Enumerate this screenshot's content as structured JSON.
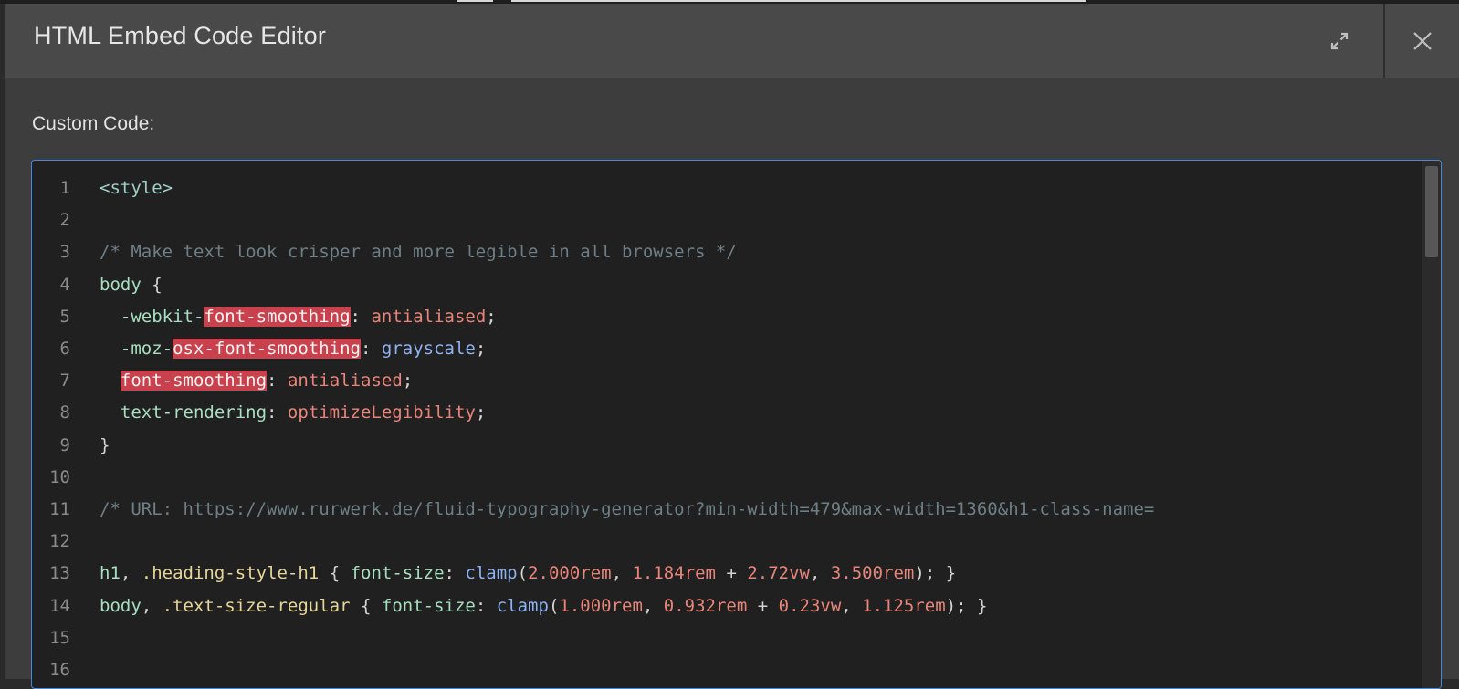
{
  "header": {
    "title": "HTML Embed Code Editor",
    "expand_icon": "expand-icon",
    "close_icon": "close-icon"
  },
  "form": {
    "label": "Custom Code:"
  },
  "editor": {
    "line_numbers": [
      "1",
      "2",
      "3",
      "4",
      "5",
      "6",
      "7",
      "8",
      "9",
      "10",
      "11",
      "12",
      "13",
      "14",
      "15",
      "16"
    ],
    "lines": [
      [
        {
          "t": "<style>",
          "k": "tag"
        }
      ],
      [],
      [
        {
          "t": "/* Make text look crisper and more legible in all browsers */",
          "k": "comment"
        }
      ],
      [
        {
          "t": "body",
          "k": "selector"
        },
        {
          "t": " {",
          "k": "punct"
        }
      ],
      [
        {
          "t": "  -webkit-",
          "k": "prop"
        },
        {
          "t": "font-smoothing",
          "k": "hl"
        },
        {
          "t": ": ",
          "k": "punct"
        },
        {
          "t": "antialiased",
          "k": "val"
        },
        {
          "t": ";",
          "k": "punct"
        }
      ],
      [
        {
          "t": "  -moz-",
          "k": "prop"
        },
        {
          "t": "osx-font-smoothing",
          "k": "hl"
        },
        {
          "t": ": ",
          "k": "punct"
        },
        {
          "t": "grayscale",
          "k": "kw"
        },
        {
          "t": ";",
          "k": "punct"
        }
      ],
      [
        {
          "t": "  ",
          "k": "punct"
        },
        {
          "t": "font-smoothing",
          "k": "hl"
        },
        {
          "t": ": ",
          "k": "punct"
        },
        {
          "t": "antialiased",
          "k": "val"
        },
        {
          "t": ";",
          "k": "punct"
        }
      ],
      [
        {
          "t": "  text-rendering",
          "k": "prop"
        },
        {
          "t": ": ",
          "k": "punct"
        },
        {
          "t": "optimizeLegibility",
          "k": "val"
        },
        {
          "t": ";",
          "k": "punct"
        }
      ],
      [
        {
          "t": "}",
          "k": "punct"
        }
      ],
      [],
      [
        {
          "t": "/* URL: https://www.rurwerk.de/fluid-typography-generator?min-width=479&max-width=1360&h1-class-name=",
          "k": "comment"
        }
      ],
      [],
      [
        {
          "t": "h1",
          "k": "selector"
        },
        {
          "t": ", ",
          "k": "punct"
        },
        {
          "t": ".heading-style-h1",
          "k": "class"
        },
        {
          "t": " { ",
          "k": "punct"
        },
        {
          "t": "font-size",
          "k": "prop"
        },
        {
          "t": ": ",
          "k": "punct"
        },
        {
          "t": "clamp",
          "k": "kw"
        },
        {
          "t": "(",
          "k": "punct"
        },
        {
          "t": "2.000rem",
          "k": "val"
        },
        {
          "t": ", ",
          "k": "punct"
        },
        {
          "t": "1.184rem",
          "k": "val"
        },
        {
          "t": " + ",
          "k": "punct"
        },
        {
          "t": "2.72vw",
          "k": "val"
        },
        {
          "t": ", ",
          "k": "punct"
        },
        {
          "t": "3.500rem",
          "k": "val"
        },
        {
          "t": "); }",
          "k": "punct"
        }
      ],
      [
        {
          "t": "body",
          "k": "selector"
        },
        {
          "t": ", ",
          "k": "punct"
        },
        {
          "t": ".text-size-regular",
          "k": "class"
        },
        {
          "t": " { ",
          "k": "punct"
        },
        {
          "t": "font-size",
          "k": "prop"
        },
        {
          "t": ": ",
          "k": "punct"
        },
        {
          "t": "clamp",
          "k": "kw"
        },
        {
          "t": "(",
          "k": "punct"
        },
        {
          "t": "1.000rem",
          "k": "val"
        },
        {
          "t": ", ",
          "k": "punct"
        },
        {
          "t": "0.932rem",
          "k": "val"
        },
        {
          "t": " + ",
          "k": "punct"
        },
        {
          "t": "0.23vw",
          "k": "val"
        },
        {
          "t": ", ",
          "k": "punct"
        },
        {
          "t": "1.125rem",
          "k": "val"
        },
        {
          "t": "); }",
          "k": "punct"
        }
      ],
      [],
      []
    ]
  },
  "colors": {
    "accent_border": "#4a88e0",
    "highlight": "#c8414c"
  }
}
